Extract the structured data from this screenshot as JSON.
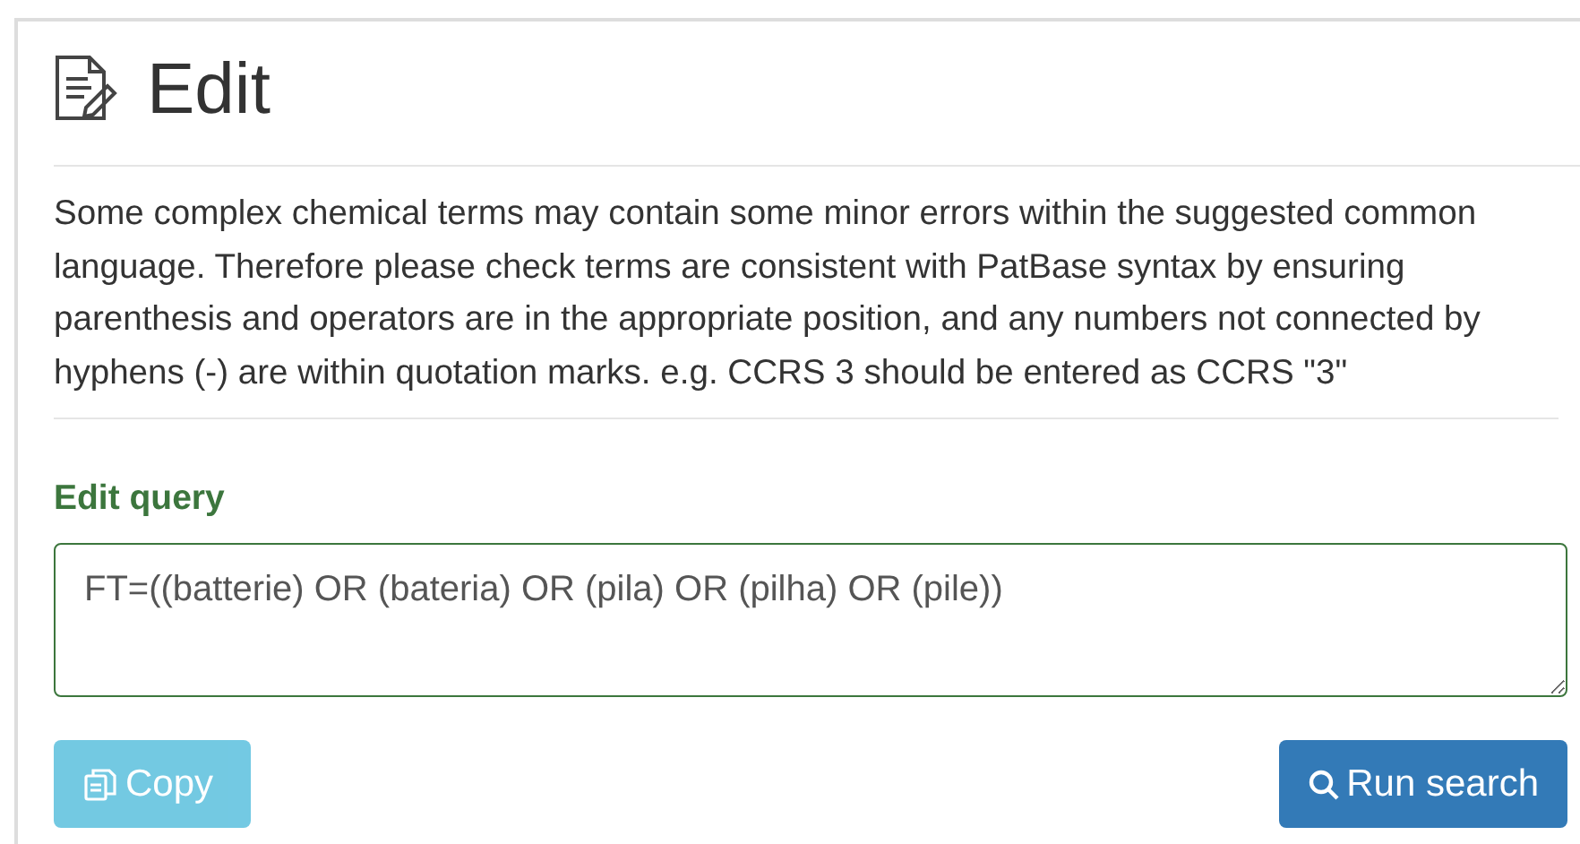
{
  "panel": {
    "title": "Edit"
  },
  "notice": "Some complex chemical terms may contain some minor errors within the suggested common language. Therefore please check terms are consistent with PatBase syntax by ensuring parenthesis and operators are in the appropriate position, and any numbers not connected by hyphens (-) are within quotation marks. e.g. CCRS 3 should be entered as CCRS \"3\"",
  "query": {
    "label": "Edit query",
    "value": "FT=((batterie) OR (bateria) OR (pila) OR (pilha) OR (pile))"
  },
  "buttons": [
    {
      "kind": "copy",
      "label": "Copy",
      "disabled": true
    },
    {
      "kind": "search",
      "label": "Run search",
      "disabled": false
    }
  ]
}
